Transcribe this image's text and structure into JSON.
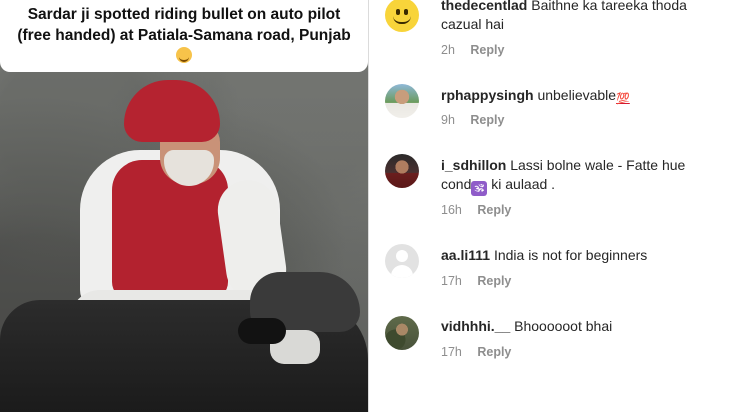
{
  "media": {
    "caption": "Sardar ji spotted riding bullet on auto pilot (free handed) at Patiala-Samana road, Punjab",
    "caption_emoji": "grinning-sweat-emoji"
  },
  "comments": [
    {
      "username": "thedecentlad",
      "text": "Baithne ka tareeka thoda cazual hai",
      "time": "2h",
      "reply": "Reply",
      "avatar": "smiley-avatar"
    },
    {
      "username": "rphappysingh",
      "text": "unbelievable",
      "emoji": "💯",
      "time": "9h",
      "reply": "Reply",
      "avatar": "photo-avatar"
    },
    {
      "username": "i_sdhillon",
      "text_before": "Lassi bolne wale - Fatte hue cond",
      "emoji": "🕉",
      "text_after": " ki aulaad .",
      "time": "16h",
      "reply": "Reply",
      "avatar": "photo-avatar"
    },
    {
      "username": "aa.li111",
      "text": "India is not for beginners",
      "time": "17h",
      "reply": "Reply",
      "avatar": "default-avatar"
    },
    {
      "username": "vidhhhi.__",
      "text": "Bhoooooot bhai",
      "time": "17h",
      "reply": "Reply",
      "avatar": "photo-avatar"
    }
  ],
  "colors": {
    "text": "#262626",
    "meta": "#8e8e8e",
    "divider": "#dbdbdb",
    "turban": "#b52330"
  }
}
